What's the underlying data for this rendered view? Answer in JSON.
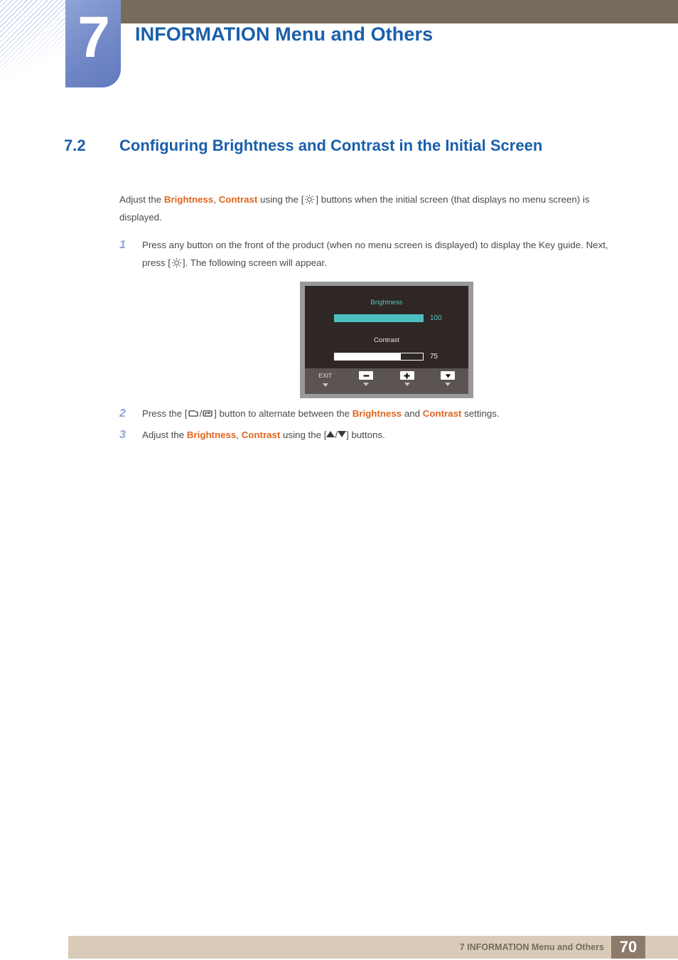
{
  "header": {
    "chapter_number": "7",
    "chapter_title": "INFORMATION Menu and Others",
    "bar_color": "#776B5B",
    "badge_color": "#6f86c6",
    "title_color": "#1a5fab"
  },
  "section": {
    "number": "7.2",
    "title": "Configuring Brightness and Contrast in the Initial Screen"
  },
  "intro": {
    "t1": "Adjust the ",
    "b1": "Brightness",
    "t2": ", ",
    "b2": "Contrast",
    "t3": " using the [",
    "icon": "brightness-sun-icon",
    "t4": "] buttons when the initial screen (that displays no menu screen) is displayed."
  },
  "steps": [
    {
      "number": "1",
      "t1": "Press any button on the front of the product (when no menu screen is displayed) to display the Key guide. Next, press [",
      "icon": "brightness-sun-icon",
      "t2": "]. The following screen will appear."
    },
    {
      "number": "2",
      "t1": "Press the [",
      "icon1": "menu-back-icon",
      "sep": "/",
      "icon2": "enter-icon",
      "t2": "] button to alternate between the ",
      "b1": "Brightness",
      "t3": " and ",
      "b2": "Contrast",
      "t4": " settings."
    },
    {
      "number": "3",
      "t1": "Adjust the ",
      "b1": "Brightness",
      "t2": ", ",
      "b2": "Contrast",
      "t3": " using the [",
      "icon1": "arrow-up-icon",
      "sep": "/",
      "icon2": "arrow-down-icon",
      "t4": "] buttons."
    }
  ],
  "osd": {
    "brightness_label": "Brightness",
    "brightness_value": "100",
    "brightness_percent": 100,
    "brightness_color": "#5bc4c4",
    "contrast_label": "Contrast",
    "contrast_value": "75",
    "contrast_percent": 75,
    "contrast_color": "#ffffff",
    "background": "#2e2725",
    "border": "#9a9a9a",
    "buttons": [
      {
        "caption": "EXIT",
        "icon": "exit-label"
      },
      {
        "caption": "",
        "icon": "minus-icon"
      },
      {
        "caption": "",
        "icon": "plus-icon"
      },
      {
        "caption": "",
        "icon": "down-arrow-icon"
      }
    ]
  },
  "footer": {
    "text": "7 INFORMATION Menu and Others",
    "page_number": "70",
    "bar_color": "#d8cbb8",
    "page_box_color": "#8c7a6b"
  }
}
